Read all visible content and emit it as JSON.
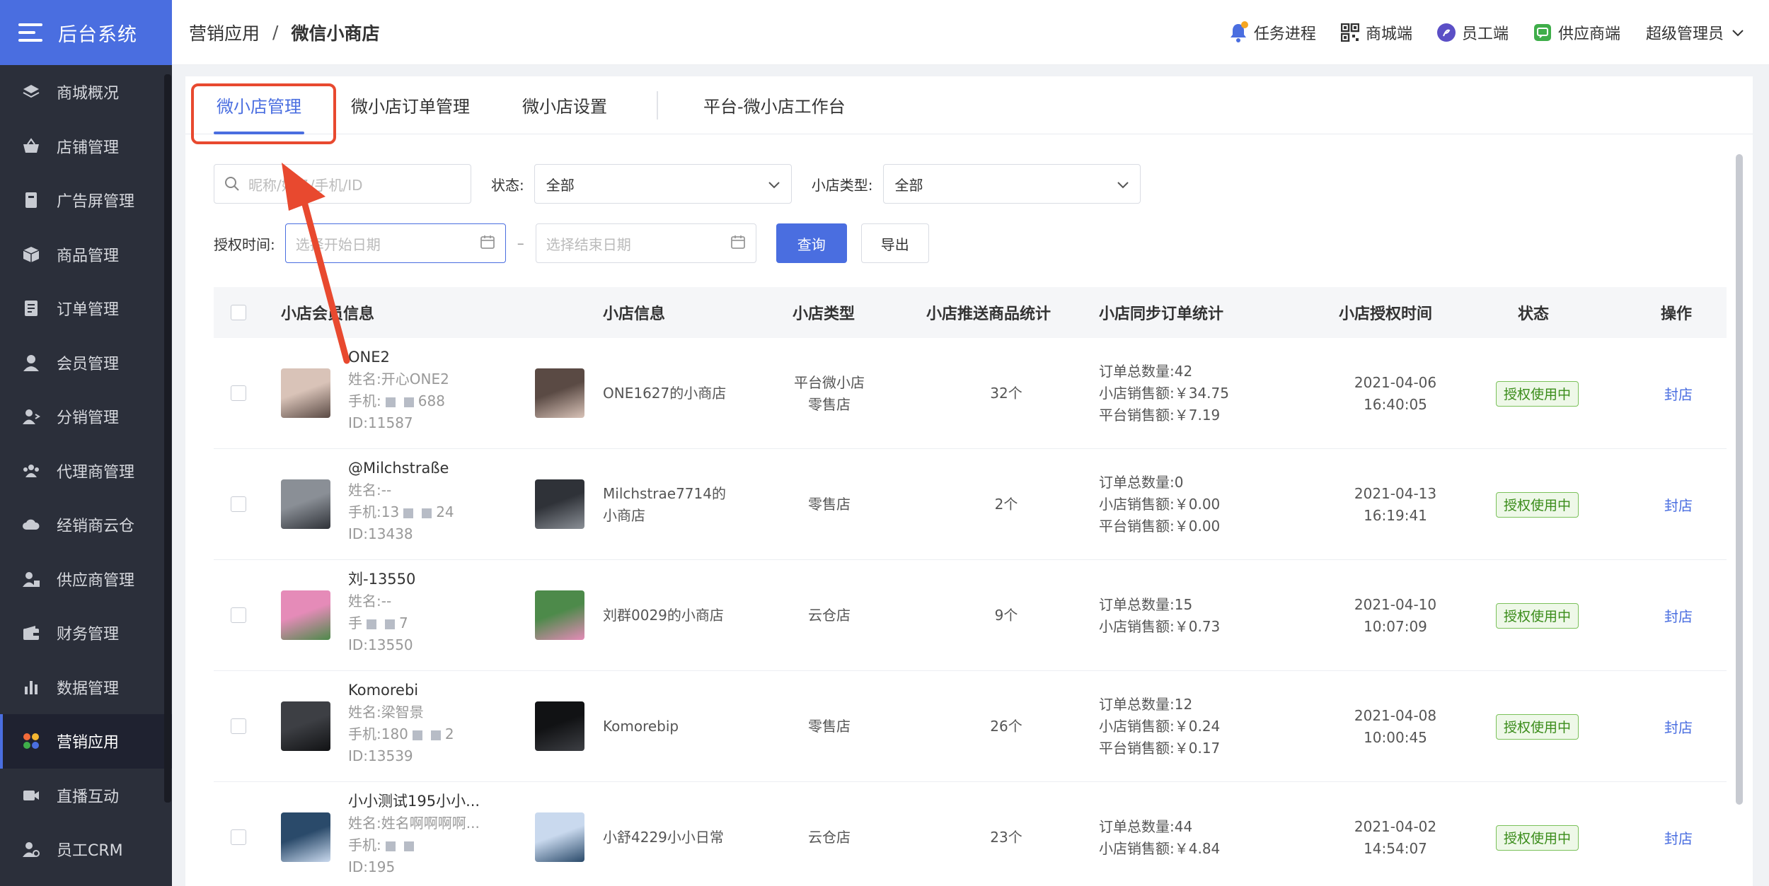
{
  "brand": {
    "title": "后台系统"
  },
  "sidebar": {
    "items": [
      {
        "label": "商城概况",
        "icon": "layers-icon"
      },
      {
        "label": "店铺管理",
        "icon": "basket-icon"
      },
      {
        "label": "广告屏管理",
        "icon": "screen-icon"
      },
      {
        "label": "商品管理",
        "icon": "box-icon"
      },
      {
        "label": "订单管理",
        "icon": "order-icon"
      },
      {
        "label": "会员管理",
        "icon": "user-icon"
      },
      {
        "label": "分销管理",
        "icon": "share-user-icon"
      },
      {
        "label": "代理商管理",
        "icon": "group-icon"
      },
      {
        "label": "经销商云仓",
        "icon": "cloud-icon"
      },
      {
        "label": "供应商管理",
        "icon": "supplier-icon"
      },
      {
        "label": "财务管理",
        "icon": "wallet-icon"
      },
      {
        "label": "数据管理",
        "icon": "bar-chart-icon"
      },
      {
        "label": "营销应用",
        "icon": "apps-icon",
        "active": true
      },
      {
        "label": "直播互动",
        "icon": "video-icon"
      },
      {
        "label": "员工CRM",
        "icon": "crm-icon"
      }
    ]
  },
  "header": {
    "breadcrumb": [
      "营销应用",
      "微信小商店"
    ],
    "separator": "/",
    "links": [
      {
        "label": "任务进程",
        "icon": "bell-icon"
      },
      {
        "label": "商城端",
        "icon": "qrcode-icon"
      },
      {
        "label": "员工端",
        "icon": "staff-icon"
      },
      {
        "label": "供应商端",
        "icon": "supplier-app-icon"
      }
    ],
    "admin": "超级管理员"
  },
  "tabs": [
    "微小店管理",
    "微小店订单管理",
    "微小店设置",
    "平台-微小店工作台"
  ],
  "filters": {
    "search_placeholder": "昵称/姓名/手机/ID",
    "status_label": "状态:",
    "status_value": "全部",
    "type_label": "小店类型:",
    "type_value": "全部",
    "auth_time_label": "授权时间:",
    "start_placeholder": "选择开始日期",
    "dash": "–",
    "end_placeholder": "选择结束日期",
    "query_button": "查询",
    "export_button": "导出"
  },
  "table": {
    "headers": [
      "小店会员信息",
      "小店信息",
      "小店类型",
      "小店推送商品统计",
      "小店同步订单统计",
      "小店授权时间",
      "状态",
      "操作"
    ],
    "rows": [
      {
        "nick": "ONE2",
        "name": "姓名:开心ONE2",
        "phone_prefix": "手机:",
        "phone_suffix": "688",
        "id": "ID:11587",
        "shop": "ONE1627的小商店",
        "type": [
          "平台微小店",
          "零售店"
        ],
        "goods": "32个",
        "stats": [
          "订单总数量:42",
          "小店销售额:￥34.75",
          "平台销售额:￥7.19"
        ],
        "date": "2021-04-06",
        "time": "16:40:05",
        "status": "授权使用中",
        "action": "封店",
        "av1": "#d9c3b8",
        "av2": "#5a4a44"
      },
      {
        "nick": "@Milchstraße",
        "name": "姓名:--",
        "phone_prefix": "手机:13",
        "phone_suffix": "24",
        "id": "ID:13438",
        "shop": "Milchstrae7714的小商店",
        "type": [
          "零售店"
        ],
        "goods": "2个",
        "stats": [
          "订单总数量:0",
          "小店销售额:￥0.00",
          "平台销售额:￥0.00"
        ],
        "date": "2021-04-13",
        "time": "16:19:41",
        "status": "授权使用中",
        "action": "封店",
        "av1": "#8a8f96",
        "av2": "#2f3238"
      },
      {
        "nick": "刘-13550",
        "name": "姓名:--",
        "phone_prefix": "手",
        "phone_suffix": "7",
        "id": "ID:13550",
        "shop": "刘群0029的小商店",
        "type": [
          "云仓店"
        ],
        "goods": "9个",
        "stats": [
          "订单总数量:15",
          "小店销售额:￥0.73"
        ],
        "date": "2021-04-10",
        "time": "10:07:09",
        "status": "授权使用中",
        "action": "封店",
        "av1": "#e58bb8",
        "av2": "#4d8a4a"
      },
      {
        "nick": "Komorebi",
        "name": "姓名:梁智景",
        "phone_prefix": "手机:180",
        "phone_suffix": "2",
        "id": "ID:13539",
        "shop": "Komorebip",
        "type": [
          "零售店"
        ],
        "goods": "26个",
        "stats": [
          "订单总数量:12",
          "小店销售额:￥0.24",
          "平台销售额:￥0.17"
        ],
        "date": "2021-04-08",
        "time": "10:00:45",
        "status": "授权使用中",
        "action": "封店",
        "av1": "#3d3f44",
        "av2": "#111214"
      },
      {
        "nick": "小小测试195小小...",
        "name": "姓名:姓名啊啊啊啊...",
        "phone_prefix": "手机:",
        "phone_suffix": "",
        "id": "ID:195",
        "shop": "小舒4229小小日常",
        "type": [
          "云仓店"
        ],
        "goods": "23个",
        "stats": [
          "订单总数量:44",
          "小店销售额:￥4.84"
        ],
        "date": "2021-04-02",
        "time": "14:54:07",
        "status": "授权使用中",
        "action": "封店",
        "av1": "#2a4a6a",
        "av2": "#c9d9ee"
      }
    ]
  },
  "colors": {
    "accent": "#4a6ee0",
    "sidebar_bg": "#2b2f3a",
    "highlight": "#e8492f",
    "badge_green": "#7bc15a"
  }
}
